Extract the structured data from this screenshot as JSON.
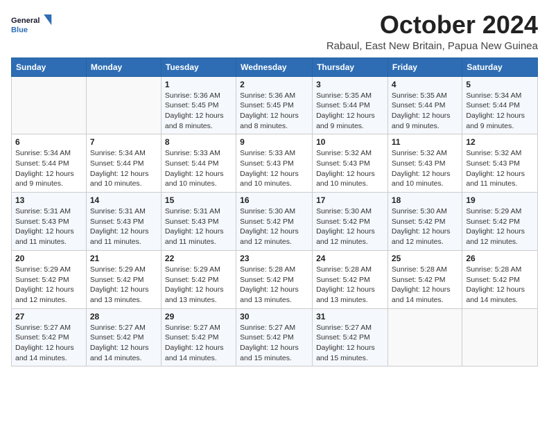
{
  "logo": {
    "line1": "General",
    "line2": "Blue"
  },
  "title": "October 2024",
  "subtitle": "Rabaul, East New Britain, Papua New Guinea",
  "weekdays": [
    "Sunday",
    "Monday",
    "Tuesday",
    "Wednesday",
    "Thursday",
    "Friday",
    "Saturday"
  ],
  "weeks": [
    [
      {
        "day": "",
        "detail": ""
      },
      {
        "day": "",
        "detail": ""
      },
      {
        "day": "1",
        "detail": "Sunrise: 5:36 AM\nSunset: 5:45 PM\nDaylight: 12 hours\nand 8 minutes."
      },
      {
        "day": "2",
        "detail": "Sunrise: 5:36 AM\nSunset: 5:45 PM\nDaylight: 12 hours\nand 8 minutes."
      },
      {
        "day": "3",
        "detail": "Sunrise: 5:35 AM\nSunset: 5:44 PM\nDaylight: 12 hours\nand 9 minutes."
      },
      {
        "day": "4",
        "detail": "Sunrise: 5:35 AM\nSunset: 5:44 PM\nDaylight: 12 hours\nand 9 minutes."
      },
      {
        "day": "5",
        "detail": "Sunrise: 5:34 AM\nSunset: 5:44 PM\nDaylight: 12 hours\nand 9 minutes."
      }
    ],
    [
      {
        "day": "6",
        "detail": "Sunrise: 5:34 AM\nSunset: 5:44 PM\nDaylight: 12 hours\nand 9 minutes."
      },
      {
        "day": "7",
        "detail": "Sunrise: 5:34 AM\nSunset: 5:44 PM\nDaylight: 12 hours\nand 10 minutes."
      },
      {
        "day": "8",
        "detail": "Sunrise: 5:33 AM\nSunset: 5:44 PM\nDaylight: 12 hours\nand 10 minutes."
      },
      {
        "day": "9",
        "detail": "Sunrise: 5:33 AM\nSunset: 5:43 PM\nDaylight: 12 hours\nand 10 minutes."
      },
      {
        "day": "10",
        "detail": "Sunrise: 5:32 AM\nSunset: 5:43 PM\nDaylight: 12 hours\nand 10 minutes."
      },
      {
        "day": "11",
        "detail": "Sunrise: 5:32 AM\nSunset: 5:43 PM\nDaylight: 12 hours\nand 10 minutes."
      },
      {
        "day": "12",
        "detail": "Sunrise: 5:32 AM\nSunset: 5:43 PM\nDaylight: 12 hours\nand 11 minutes."
      }
    ],
    [
      {
        "day": "13",
        "detail": "Sunrise: 5:31 AM\nSunset: 5:43 PM\nDaylight: 12 hours\nand 11 minutes."
      },
      {
        "day": "14",
        "detail": "Sunrise: 5:31 AM\nSunset: 5:43 PM\nDaylight: 12 hours\nand 11 minutes."
      },
      {
        "day": "15",
        "detail": "Sunrise: 5:31 AM\nSunset: 5:43 PM\nDaylight: 12 hours\nand 11 minutes."
      },
      {
        "day": "16",
        "detail": "Sunrise: 5:30 AM\nSunset: 5:42 PM\nDaylight: 12 hours\nand 12 minutes."
      },
      {
        "day": "17",
        "detail": "Sunrise: 5:30 AM\nSunset: 5:42 PM\nDaylight: 12 hours\nand 12 minutes."
      },
      {
        "day": "18",
        "detail": "Sunrise: 5:30 AM\nSunset: 5:42 PM\nDaylight: 12 hours\nand 12 minutes."
      },
      {
        "day": "19",
        "detail": "Sunrise: 5:29 AM\nSunset: 5:42 PM\nDaylight: 12 hours\nand 12 minutes."
      }
    ],
    [
      {
        "day": "20",
        "detail": "Sunrise: 5:29 AM\nSunset: 5:42 PM\nDaylight: 12 hours\nand 12 minutes."
      },
      {
        "day": "21",
        "detail": "Sunrise: 5:29 AM\nSunset: 5:42 PM\nDaylight: 12 hours\nand 13 minutes."
      },
      {
        "day": "22",
        "detail": "Sunrise: 5:29 AM\nSunset: 5:42 PM\nDaylight: 12 hours\nand 13 minutes."
      },
      {
        "day": "23",
        "detail": "Sunrise: 5:28 AM\nSunset: 5:42 PM\nDaylight: 12 hours\nand 13 minutes."
      },
      {
        "day": "24",
        "detail": "Sunrise: 5:28 AM\nSunset: 5:42 PM\nDaylight: 12 hours\nand 13 minutes."
      },
      {
        "day": "25",
        "detail": "Sunrise: 5:28 AM\nSunset: 5:42 PM\nDaylight: 12 hours\nand 14 minutes."
      },
      {
        "day": "26",
        "detail": "Sunrise: 5:28 AM\nSunset: 5:42 PM\nDaylight: 12 hours\nand 14 minutes."
      }
    ],
    [
      {
        "day": "27",
        "detail": "Sunrise: 5:27 AM\nSunset: 5:42 PM\nDaylight: 12 hours\nand 14 minutes."
      },
      {
        "day": "28",
        "detail": "Sunrise: 5:27 AM\nSunset: 5:42 PM\nDaylight: 12 hours\nand 14 minutes."
      },
      {
        "day": "29",
        "detail": "Sunrise: 5:27 AM\nSunset: 5:42 PM\nDaylight: 12 hours\nand 14 minutes."
      },
      {
        "day": "30",
        "detail": "Sunrise: 5:27 AM\nSunset: 5:42 PM\nDaylight: 12 hours\nand 15 minutes."
      },
      {
        "day": "31",
        "detail": "Sunrise: 5:27 AM\nSunset: 5:42 PM\nDaylight: 12 hours\nand 15 minutes."
      },
      {
        "day": "",
        "detail": ""
      },
      {
        "day": "",
        "detail": ""
      }
    ]
  ]
}
